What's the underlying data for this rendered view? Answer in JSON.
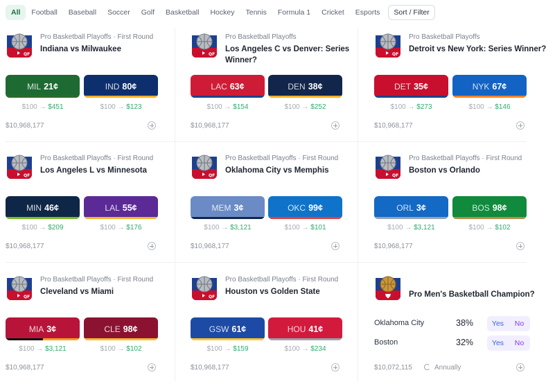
{
  "tabs": [
    "All",
    "Football",
    "Baseball",
    "Soccer",
    "Golf",
    "Basketball",
    "Hockey",
    "Tennis",
    "Formula 1",
    "Cricket",
    "Esports"
  ],
  "sort_label": "Sort / Filter",
  "colors": {
    "accent_green": "#2fab6c",
    "tab_active_bg": "#e6f5ee",
    "yes_no_bg": "#f1efff"
  },
  "markets": [
    {
      "subtitle": "Pro Basketball Playoffs · First Round",
      "title": "Indiana vs Milwaukee",
      "volume": "$10,968,177",
      "options": [
        {
          "abbr": "MIL",
          "price": "21¢",
          "stake": "$100 →",
          "payout": "$451",
          "bg": "#1d6b32",
          "stripe_a": "#2b6a2f",
          "stripe_b": "#2b6a2f"
        },
        {
          "abbr": "IND",
          "price": "80¢",
          "stake": "$100 →",
          "payout": "$123",
          "bg": "#0e2f6e",
          "stripe_a": "#f2b12b",
          "stripe_b": "#f2b12b"
        }
      ]
    },
    {
      "subtitle": "Pro Basketball Playoffs",
      "title": "Los Angeles C vs Denver: Series Winner?",
      "volume": "$10,968,177",
      "options": [
        {
          "abbr": "LAC",
          "price": "63¢",
          "stake": "$100 →",
          "payout": "$154",
          "bg": "#cf1c36",
          "stripe_a": "#1d428a",
          "stripe_b": "#1d428a"
        },
        {
          "abbr": "DEN",
          "price": "38¢",
          "stake": "$100 →",
          "payout": "$252",
          "bg": "#11264a",
          "stripe_a": "#f5b129",
          "stripe_b": "#f5b129"
        }
      ]
    },
    {
      "subtitle": "Pro Basketball Playoffs",
      "title": "Detroit vs New York: Series Winner?",
      "volume": "$10,968,177",
      "options": [
        {
          "abbr": "DET",
          "price": "35¢",
          "stake": "$100 →",
          "payout": "$273",
          "bg": "#c8102e",
          "stripe_a": "#1d428a",
          "stripe_b": "#1d428a"
        },
        {
          "abbr": "NYK",
          "price": "67¢",
          "stake": "$100 →",
          "payout": "$146",
          "bg": "#1263c4",
          "stripe_a": "#f58426",
          "stripe_b": "#f58426"
        }
      ]
    },
    {
      "subtitle": "Pro Basketball Playoffs · First Round",
      "title": "Los Angeles L vs Minnesota",
      "volume": "$10,968,177",
      "options": [
        {
          "abbr": "MIN",
          "price": "46¢",
          "stake": "$100 →",
          "payout": "$209",
          "bg": "#0f2747",
          "stripe_a": "#78be20",
          "stripe_b": "#78be20"
        },
        {
          "abbr": "LAL",
          "price": "55¢",
          "stake": "$100 →",
          "payout": "$176",
          "bg": "#5b2a96",
          "stripe_a": "#f5b72a",
          "stripe_b": "#f5b72a"
        }
      ]
    },
    {
      "subtitle": "Pro Basketball Playoffs · First Round",
      "title": "Oklahoma City vs Memphis",
      "volume": "$10,968,177",
      "options": [
        {
          "abbr": "MEM",
          "price": "3¢",
          "stake": "$100 →",
          "payout": "$3,121",
          "bg": "#6a8bc5",
          "stripe_a": "#11264a",
          "stripe_b": "#11264a"
        },
        {
          "abbr": "OKC",
          "price": "99¢",
          "stake": "$100 →",
          "payout": "$101",
          "bg": "#0f73c9",
          "stripe_a": "#e3413a",
          "stripe_b": "#e3413a"
        }
      ]
    },
    {
      "subtitle": "Pro Basketball Playoffs · First Round",
      "title": "Boston vs Orlando",
      "volume": "$10,968,177",
      "options": [
        {
          "abbr": "ORL",
          "price": "3¢",
          "stake": "$100 →",
          "payout": "$3,121",
          "bg": "#1369c4",
          "stripe_a": "#9aa3ad",
          "stripe_b": "#9aa3ad"
        },
        {
          "abbr": "BOS",
          "price": "98¢",
          "stake": "$100 →",
          "payout": "$102",
          "bg": "#108a3c",
          "stripe_a": "#b88d45",
          "stripe_b": "#b88d45"
        }
      ]
    },
    {
      "subtitle": "Pro Basketball Playoffs · First Round",
      "title": "Cleveland vs Miami",
      "volume": "$10,968,177",
      "options": [
        {
          "abbr": "MIA",
          "price": "3¢",
          "stake": "$100 →",
          "payout": "$3,121",
          "bg": "#b8143a",
          "stripe_a": "#111111",
          "stripe_b": "#f9a01b"
        },
        {
          "abbr": "CLE",
          "price": "98¢",
          "stake": "$100 →",
          "payout": "$102",
          "bg": "#8b1331",
          "stripe_a": "#fdbb30",
          "stripe_b": "#fdbb30"
        }
      ]
    },
    {
      "subtitle": "Pro Basketball Playoffs · First Round",
      "title": "Houston vs Golden State",
      "volume": "$10,968,177",
      "options": [
        {
          "abbr": "GSW",
          "price": "61¢",
          "stake": "$100 →",
          "payout": "$159",
          "bg": "#1d4aa4",
          "stripe_a": "#ffc72c",
          "stripe_b": "#ffc72c"
        },
        {
          "abbr": "HOU",
          "price": "41¢",
          "stake": "$100 →",
          "payout": "$234",
          "bg": "#d21a3d",
          "stripe_a": "#9aa3ad",
          "stripe_b": "#9aa3ad"
        }
      ]
    }
  ],
  "champion": {
    "title": "Pro Men's Basketball Champion?",
    "volume": "$10,072,115",
    "frequency": "Annually",
    "rows": [
      {
        "name": "Oklahoma City",
        "pct": "38%",
        "yes": "Yes",
        "no": "No"
      },
      {
        "name": "Boston",
        "pct": "32%",
        "yes": "Yes",
        "no": "No"
      }
    ]
  }
}
